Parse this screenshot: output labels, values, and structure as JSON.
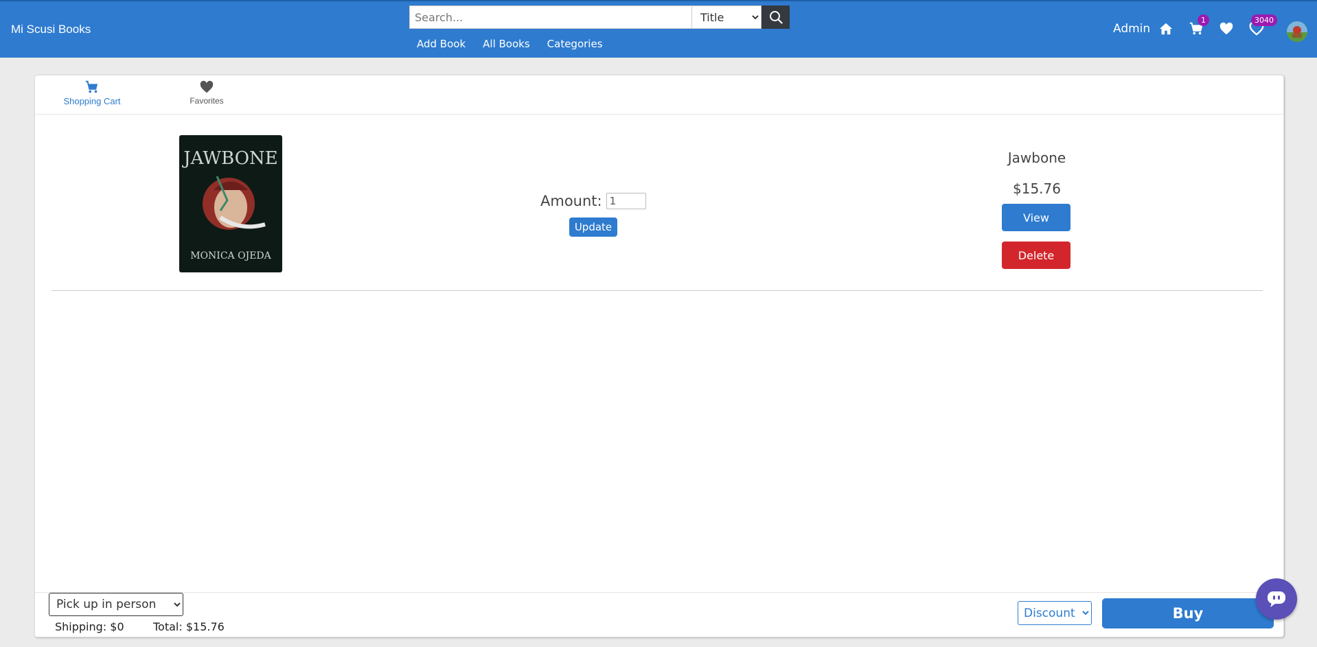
{
  "header": {
    "brand": "Mi Scusi Books",
    "search": {
      "placeholder": "Search...",
      "selected_field": "Title"
    },
    "nav": [
      "Add Book",
      "All Books",
      "Categories"
    ],
    "user_label": "Admin",
    "cart_count": "1",
    "notifications_count": "3040",
    "icons": [
      "home-icon",
      "cart-icon",
      "heart-icon",
      "heart-notification-icon",
      "avatar"
    ],
    "accent_color": "#2e7bcf",
    "badge_color": "#9b1bb0"
  },
  "tabs": [
    {
      "label": "Shopping Cart",
      "icon": "cart-icon",
      "active": true
    },
    {
      "label": "Favorites",
      "icon": "heart-icon",
      "active": false
    }
  ],
  "cart_item": {
    "cover_title": "JAWBONE",
    "cover_author": "MONICA OJEDA",
    "amount_label": "Amount:",
    "amount_value": "1",
    "update_label": "Update",
    "title": "Jawbone",
    "price": "$15.76",
    "view_label": "View",
    "delete_label": "Delete",
    "delete_color": "#d3262c"
  },
  "footer": {
    "shipping_option": "Pick up in person",
    "shipping_text": "Shipping: $0",
    "total_text": "Total: $15.76",
    "discount_option": "Discount",
    "buy_label": "Buy"
  }
}
